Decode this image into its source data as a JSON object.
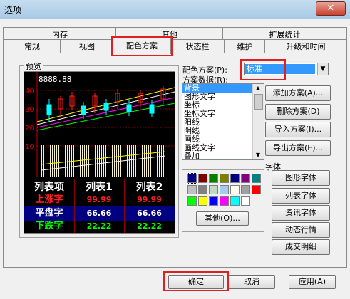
{
  "window": {
    "title": "选项",
    "close_glyph": "✕"
  },
  "tabs": {
    "row1": [
      "内存",
      "其他",
      "扩展统计"
    ],
    "row2": [
      "常规",
      "视图",
      "配色方案",
      "状态栏",
      "维护",
      "升级和时间"
    ],
    "active": "配色方案"
  },
  "preview": {
    "group_label": "预览",
    "price_text": "8888.88",
    "axis_labels": [
      "40",
      "30",
      "20",
      "10"
    ],
    "table": {
      "headers": [
        "列表项",
        "列表1",
        "列表2"
      ],
      "rows": [
        {
          "label": "上涨字",
          "v1": "99.99",
          "v2": "99.99"
        },
        {
          "label": "平盘字",
          "v1": "66.66",
          "v2": "66.66"
        },
        {
          "label": "下跌字",
          "v1": "22.22",
          "v2": "22.22"
        }
      ]
    }
  },
  "scheme": {
    "label": "配色方案(P):",
    "value": "标准",
    "data_label": "方案数据(R):",
    "items": [
      "背景",
      "图形文字",
      "坐标",
      "坐标文字",
      "阳线",
      "阴线",
      "画线",
      "画线文字",
      "叠加"
    ],
    "other_button": "其他(O)...",
    "palette_rows": [
      [
        "#000080",
        "#800000",
        "#008000",
        "#808000",
        "#000080",
        "#800080",
        "#008080"
      ],
      [
        "#c0c0c0",
        "#808080",
        "#c0dcc0",
        "#a6caf0",
        "#fffbf0",
        "#a0a0a4",
        "#ff0000"
      ],
      [
        "#00ff00",
        "#ffff00",
        "#0000ff",
        "#ff00ff",
        "#00ffff",
        "#ffffff"
      ]
    ],
    "actions": [
      "添加方案(A)...",
      "删除方案(D)",
      "导入方案(I)...",
      "导出方案(E)..."
    ]
  },
  "font": {
    "group_label": "字体",
    "buttons": [
      "图形字体",
      "列表字体",
      "资讯字体",
      "动态行情",
      "成交明细"
    ]
  },
  "footer": {
    "ok": "确定",
    "cancel": "取消",
    "apply": "应用(A)"
  },
  "colors": {
    "rise": "#ff2020",
    "flat_bg": "#000080",
    "fall": "#00ff00",
    "grid": "#cc0000",
    "candle": "#00ffff"
  }
}
